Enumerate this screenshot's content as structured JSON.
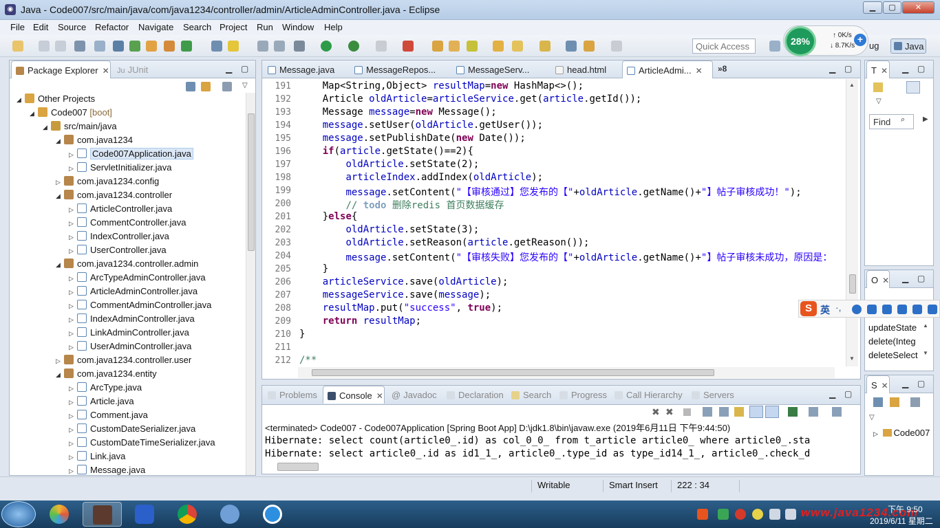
{
  "window": {
    "title": "Java - Code007/src/main/java/com/java1234/controller/admin/ArticleAdminController.java - Eclipse"
  },
  "menu": [
    "File",
    "Edit",
    "Source",
    "Refactor",
    "Navigate",
    "Search",
    "Project",
    "Run",
    "Window",
    "Help"
  ],
  "toolbar": {
    "quick_access_placeholder": "Quick Access",
    "perspective_debug": "ug",
    "perspective_java": "Java"
  },
  "network": {
    "percent": "28%",
    "up": "0K/s",
    "down": "8.7K/s"
  },
  "package_explorer": {
    "tab_label": "Package Explorer",
    "junit_label": "JUnit",
    "tree": [
      {
        "label": "Other Projects",
        "depth": 0,
        "twisty": "open",
        "icon": "proj"
      },
      {
        "label": "Code007",
        "suffix": " [boot]",
        "depth": 1,
        "twisty": "open",
        "icon": "proj"
      },
      {
        "label": "src/main/java",
        "depth": 2,
        "twisty": "open",
        "icon": "src"
      },
      {
        "label": "com.java1234",
        "depth": 3,
        "twisty": "open",
        "icon": "pkg"
      },
      {
        "label": "Code007Application.java",
        "depth": 4,
        "twisty": "closed",
        "icon": "java",
        "selected": true
      },
      {
        "label": "ServletInitializer.java",
        "depth": 4,
        "twisty": "closed",
        "icon": "java"
      },
      {
        "label": "com.java1234.config",
        "depth": 3,
        "twisty": "closed",
        "icon": "pkg"
      },
      {
        "label": "com.java1234.controller",
        "depth": 3,
        "twisty": "open",
        "icon": "pkg"
      },
      {
        "label": "ArticleController.java",
        "depth": 4,
        "twisty": "closed",
        "icon": "java"
      },
      {
        "label": "CommentController.java",
        "depth": 4,
        "twisty": "closed",
        "icon": "java"
      },
      {
        "label": "IndexController.java",
        "depth": 4,
        "twisty": "closed",
        "icon": "java"
      },
      {
        "label": "UserController.java",
        "depth": 4,
        "twisty": "closed",
        "icon": "java"
      },
      {
        "label": "com.java1234.controller.admin",
        "depth": 3,
        "twisty": "open",
        "icon": "pkg"
      },
      {
        "label": "ArcTypeAdminController.java",
        "depth": 4,
        "twisty": "closed",
        "icon": "java"
      },
      {
        "label": "ArticleAdminController.java",
        "depth": 4,
        "twisty": "closed",
        "icon": "java"
      },
      {
        "label": "CommentAdminController.java",
        "depth": 4,
        "twisty": "closed",
        "icon": "java"
      },
      {
        "label": "IndexAdminController.java",
        "depth": 4,
        "twisty": "closed",
        "icon": "java"
      },
      {
        "label": "LinkAdminController.java",
        "depth": 4,
        "twisty": "closed",
        "icon": "java"
      },
      {
        "label": "UserAdminController.java",
        "depth": 4,
        "twisty": "closed",
        "icon": "java"
      },
      {
        "label": "com.java1234.controller.user",
        "depth": 3,
        "twisty": "closed",
        "icon": "pkg"
      },
      {
        "label": "com.java1234.entity",
        "depth": 3,
        "twisty": "open",
        "icon": "pkg"
      },
      {
        "label": "ArcType.java",
        "depth": 4,
        "twisty": "closed",
        "icon": "java"
      },
      {
        "label": "Article.java",
        "depth": 4,
        "twisty": "closed",
        "icon": "java"
      },
      {
        "label": "Comment.java",
        "depth": 4,
        "twisty": "closed",
        "icon": "java"
      },
      {
        "label": "CustomDateSerializer.java",
        "depth": 4,
        "twisty": "closed",
        "icon": "java"
      },
      {
        "label": "CustomDateTimeSerializer.java",
        "depth": 4,
        "twisty": "closed",
        "icon": "java"
      },
      {
        "label": "Link.java",
        "depth": 4,
        "twisty": "closed",
        "icon": "java"
      },
      {
        "label": "Message.java",
        "depth": 4,
        "twisty": "closed",
        "icon": "java"
      }
    ]
  },
  "editor": {
    "tabs": [
      {
        "label": "Message.java",
        "active": false
      },
      {
        "label": "MessageRepos...",
        "active": false
      },
      {
        "label": "MessageServ...",
        "active": false
      },
      {
        "label": "head.html",
        "active": false
      },
      {
        "label": "ArticleAdmi...",
        "active": true
      }
    ],
    "overflow": "»8",
    "lines": [
      {
        "num": "191",
        "html": "    Map&lt;String,Object&gt; <span class=\"fld\">resultMap</span>=<span class=\"kw\">new</span> HashMap&lt;&gt;();"
      },
      {
        "num": "192",
        "html": "    Article <span class=\"fld\">oldArticle</span>=<span class=\"fld\">articleService</span>.get(<span class=\"fld\">article</span>.getId());"
      },
      {
        "num": "193",
        "html": "    Message <span class=\"fld\">message</span>=<span class=\"kw\">new</span> Message();"
      },
      {
        "num": "194",
        "html": "    <span class=\"fld\">message</span>.setUser(<span class=\"fld\">oldArticle</span>.getUser());"
      },
      {
        "num": "195",
        "html": "    <span class=\"fld\">message</span>.setPublishDate(<span class=\"kw\">new</span> Date());"
      },
      {
        "num": "196",
        "html": "    <span class=\"kw\">if</span>(<span class=\"fld\">article</span>.getState()==2){"
      },
      {
        "num": "197",
        "html": "        <span class=\"fld\">oldArticle</span>.setState(2);"
      },
      {
        "num": "198",
        "html": "        <span class=\"fld\">articleIndex</span>.addIndex(<span class=\"fld\">oldArticle</span>);"
      },
      {
        "num": "199",
        "html": "        <span class=\"fld\">message</span>.setContent(<span class=\"str\">\"【审核通过】您发布的【\"</span>+<span class=\"fld\">oldArticle</span>.getName()+<span class=\"str\">\"】帖子审核成功！\"</span>);"
      },
      {
        "num": "200",
        "html": "        <span class=\"cmt\">// <span class=\"todo\">todo</span> 删除redis 首页数据缓存</span>"
      },
      {
        "num": "201",
        "html": "    }<span class=\"kw\">else</span>{"
      },
      {
        "num": "202",
        "html": "        <span class=\"fld\">oldArticle</span>.setState(3);"
      },
      {
        "num": "203",
        "html": "        <span class=\"fld\">oldArticle</span>.setReason(<span class=\"fld\">article</span>.getReason());"
      },
      {
        "num": "204",
        "html": "        <span class=\"fld\">message</span>.setContent(<span class=\"str\">\"【审核失败】您发布的【\"</span>+<span class=\"fld\">oldArticle</span>.getName()+<span class=\"str\">\"】帖子审核未成功，原因是：</span>"
      },
      {
        "num": "205",
        "html": "    }"
      },
      {
        "num": "206",
        "html": "    <span class=\"fld\">articleService</span>.save(<span class=\"fld\">oldArticle</span>);"
      },
      {
        "num": "207",
        "html": "    <span class=\"fld\">messageService</span>.save(<span class=\"fld\">message</span>);"
      },
      {
        "num": "208",
        "html": "    <span class=\"fld\">resultMap</span>.put(<span class=\"str\">\"success\"</span>, <span class=\"kw\">true</span>);"
      },
      {
        "num": "209",
        "html": "    <span class=\"kw\">return</span> <span class=\"fld\">resultMap</span>;"
      },
      {
        "num": "210",
        "html": "}"
      },
      {
        "num": "211",
        "html": ""
      },
      {
        "num": "212",
        "html": "<span class=\"cmt\">/**</span>"
      }
    ]
  },
  "console": {
    "tabs": [
      "Problems",
      "Console",
      "Javadoc",
      "Declaration",
      "Search",
      "Progress",
      "Call Hierarchy",
      "Servers"
    ],
    "active_tab": "Console",
    "status": "<terminated> Code007 - Code007Application [Spring Boot App] D:\\jdk1.8\\bin\\javaw.exe (2019年6月11日 下午9:44:50)",
    "lines": [
      "Hibernate: select count(article0_.id) as col_0_0_ from t_article article0_ where article0_.sta",
      "Hibernate: select article0_.id as id1_1_, article0_.type_id as type_id14_1_, article0_.check_d"
    ]
  },
  "right_panels": {
    "top_tab": "T",
    "find_label": "Find",
    "outline_tab": "O",
    "outline_items": [
      "updateState",
      "delete(Integ",
      "deleteSelect"
    ],
    "servers_tab": "S",
    "servers_item": "Code007"
  },
  "ime": {
    "lang": "英"
  },
  "status_bar": {
    "writable": "Writable",
    "insert_mode": "Smart Insert",
    "position": "222 : 34"
  },
  "taskbar": {
    "time": "下午 9:50",
    "date": "2019/6/11 星期二",
    "watermark": "www.java1234.com"
  }
}
